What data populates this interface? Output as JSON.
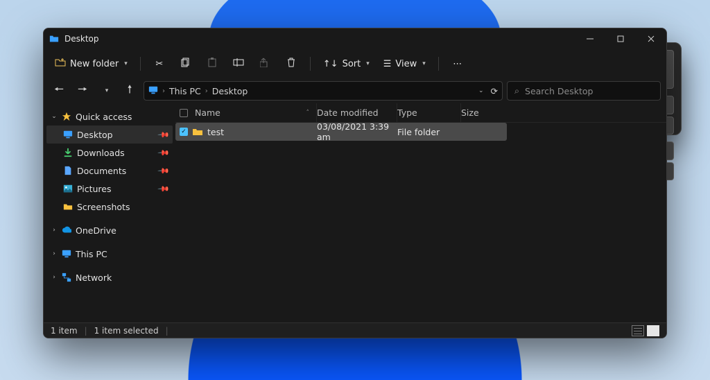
{
  "window": {
    "title": "Desktop"
  },
  "toolbar": {
    "new_label": "New folder",
    "sort_label": "Sort",
    "view_label": "View"
  },
  "address": {
    "crumbs": [
      "This PC",
      "Desktop"
    ]
  },
  "search": {
    "placeholder": "Search Desktop"
  },
  "sidebar": {
    "quick_access": "Quick access",
    "items": [
      {
        "label": "Desktop",
        "icon": "monitor",
        "pinned": true,
        "selected": true
      },
      {
        "label": "Downloads",
        "icon": "down",
        "pinned": true
      },
      {
        "label": "Documents",
        "icon": "doc",
        "pinned": true
      },
      {
        "label": "Pictures",
        "icon": "pic",
        "pinned": true
      },
      {
        "label": "Screenshots",
        "icon": "folder"
      }
    ],
    "onedrive": "OneDrive",
    "thispc": "This PC",
    "network": "Network"
  },
  "columns": {
    "name": "Name",
    "date": "Date modified",
    "type": "Type",
    "size": "Size"
  },
  "rows": [
    {
      "name": "test",
      "date": "03/08/2021 3:39 am",
      "type": "File folder"
    }
  ],
  "status": {
    "count": "1 item",
    "selected": "1 item selected"
  }
}
